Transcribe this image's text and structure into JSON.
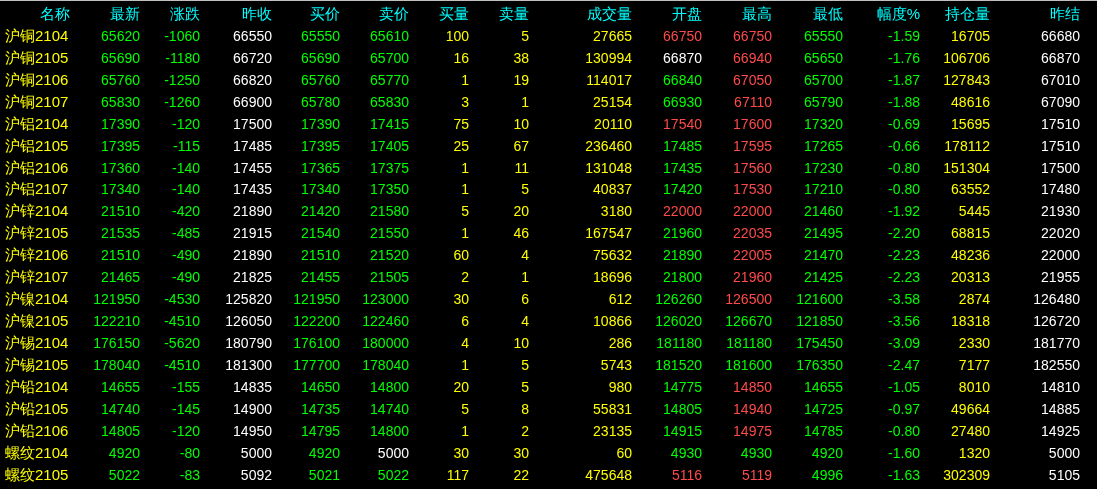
{
  "table": {
    "columns": [
      {
        "label": "名称",
        "kind": "name"
      },
      {
        "label": "最新",
        "kind": "price"
      },
      {
        "label": "涨跌",
        "kind": "price"
      },
      {
        "label": "昨收",
        "kind": "price"
      },
      {
        "label": "买价",
        "kind": "price"
      },
      {
        "label": "卖价",
        "kind": "price"
      },
      {
        "label": "买量",
        "kind": "volume"
      },
      {
        "label": "卖量",
        "kind": "volume"
      },
      {
        "label": "成交量",
        "kind": "volume"
      },
      {
        "label": "开盘",
        "kind": "price"
      },
      {
        "label": "最高",
        "kind": "price"
      },
      {
        "label": "最低",
        "kind": "price"
      },
      {
        "label": "幅度%",
        "kind": "price"
      },
      {
        "label": "持仓量",
        "kind": "volume"
      },
      {
        "label": "昨结",
        "kind": "price"
      }
    ],
    "rows": [
      {
        "cells": [
          {
            "value": "沪铜2104"
          },
          {
            "value": "65620",
            "color": "#00ff00"
          },
          {
            "value": "-1060",
            "color": "#00ff00"
          },
          {
            "value": "66550",
            "color": "#ffffff"
          },
          {
            "value": "65550",
            "color": "#00ff00"
          },
          {
            "value": "65610",
            "color": "#00ff00"
          },
          {
            "value": "100"
          },
          {
            "value": "5"
          },
          {
            "value": "27665"
          },
          {
            "value": "66750",
            "color": "#ff4a4a"
          },
          {
            "value": "66750",
            "color": "#ff4a4a"
          },
          {
            "value": "65550",
            "color": "#00ff00"
          },
          {
            "value": "-1.59",
            "color": "#00ff00"
          },
          {
            "value": "16705"
          },
          {
            "value": "66680",
            "color": "#ffffff"
          }
        ]
      },
      {
        "cells": [
          {
            "value": "沪铜2105"
          },
          {
            "value": "65690",
            "color": "#00ff00"
          },
          {
            "value": "-1180",
            "color": "#00ff00"
          },
          {
            "value": "66720",
            "color": "#ffffff"
          },
          {
            "value": "65690",
            "color": "#00ff00"
          },
          {
            "value": "65700",
            "color": "#00ff00"
          },
          {
            "value": "16"
          },
          {
            "value": "38"
          },
          {
            "value": "130994"
          },
          {
            "value": "66870",
            "color": "#ffffff"
          },
          {
            "value": "66940",
            "color": "#ff4a4a"
          },
          {
            "value": "65650",
            "color": "#00ff00"
          },
          {
            "value": "-1.76",
            "color": "#00ff00"
          },
          {
            "value": "106706"
          },
          {
            "value": "66870",
            "color": "#ffffff"
          }
        ]
      },
      {
        "cells": [
          {
            "value": "沪铜2106"
          },
          {
            "value": "65760",
            "color": "#00ff00"
          },
          {
            "value": "-1250",
            "color": "#00ff00"
          },
          {
            "value": "66820",
            "color": "#ffffff"
          },
          {
            "value": "65760",
            "color": "#00ff00"
          },
          {
            "value": "65770",
            "color": "#00ff00"
          },
          {
            "value": "1"
          },
          {
            "value": "19"
          },
          {
            "value": "114017"
          },
          {
            "value": "66840",
            "color": "#00ff00"
          },
          {
            "value": "67050",
            "color": "#ff4a4a"
          },
          {
            "value": "65700",
            "color": "#00ff00"
          },
          {
            "value": "-1.87",
            "color": "#00ff00"
          },
          {
            "value": "127843"
          },
          {
            "value": "67010",
            "color": "#ffffff"
          }
        ]
      },
      {
        "cells": [
          {
            "value": "沪铜2107"
          },
          {
            "value": "65830",
            "color": "#00ff00"
          },
          {
            "value": "-1260",
            "color": "#00ff00"
          },
          {
            "value": "66900",
            "color": "#ffffff"
          },
          {
            "value": "65780",
            "color": "#00ff00"
          },
          {
            "value": "65830",
            "color": "#00ff00"
          },
          {
            "value": "3"
          },
          {
            "value": "1"
          },
          {
            "value": "25154"
          },
          {
            "value": "66930",
            "color": "#00ff00"
          },
          {
            "value": "67110",
            "color": "#ff4a4a"
          },
          {
            "value": "65790",
            "color": "#00ff00"
          },
          {
            "value": "-1.88",
            "color": "#00ff00"
          },
          {
            "value": "48616"
          },
          {
            "value": "67090",
            "color": "#ffffff"
          }
        ]
      },
      {
        "cells": [
          {
            "value": "沪铝2104"
          },
          {
            "value": "17390",
            "color": "#00ff00"
          },
          {
            "value": "-120",
            "color": "#00ff00"
          },
          {
            "value": "17500",
            "color": "#ffffff"
          },
          {
            "value": "17390",
            "color": "#00ff00"
          },
          {
            "value": "17415",
            "color": "#00ff00"
          },
          {
            "value": "75"
          },
          {
            "value": "10"
          },
          {
            "value": "20110"
          },
          {
            "value": "17540",
            "color": "#ff4a4a"
          },
          {
            "value": "17600",
            "color": "#ff4a4a"
          },
          {
            "value": "17320",
            "color": "#00ff00"
          },
          {
            "value": "-0.69",
            "color": "#00ff00"
          },
          {
            "value": "15695"
          },
          {
            "value": "17510",
            "color": "#ffffff"
          }
        ]
      },
      {
        "cells": [
          {
            "value": "沪铝2105"
          },
          {
            "value": "17395",
            "color": "#00ff00"
          },
          {
            "value": "-115",
            "color": "#00ff00"
          },
          {
            "value": "17485",
            "color": "#ffffff"
          },
          {
            "value": "17395",
            "color": "#00ff00"
          },
          {
            "value": "17405",
            "color": "#00ff00"
          },
          {
            "value": "25"
          },
          {
            "value": "67"
          },
          {
            "value": "236460"
          },
          {
            "value": "17485",
            "color": "#00ff00"
          },
          {
            "value": "17595",
            "color": "#ff4a4a"
          },
          {
            "value": "17265",
            "color": "#00ff00"
          },
          {
            "value": "-0.66",
            "color": "#00ff00"
          },
          {
            "value": "178112"
          },
          {
            "value": "17510",
            "color": "#ffffff"
          }
        ]
      },
      {
        "cells": [
          {
            "value": "沪铝2106"
          },
          {
            "value": "17360",
            "color": "#00ff00"
          },
          {
            "value": "-140",
            "color": "#00ff00"
          },
          {
            "value": "17455",
            "color": "#ffffff"
          },
          {
            "value": "17365",
            "color": "#00ff00"
          },
          {
            "value": "17375",
            "color": "#00ff00"
          },
          {
            "value": "1"
          },
          {
            "value": "11"
          },
          {
            "value": "131048"
          },
          {
            "value": "17435",
            "color": "#00ff00"
          },
          {
            "value": "17560",
            "color": "#ff4a4a"
          },
          {
            "value": "17230",
            "color": "#00ff00"
          },
          {
            "value": "-0.80",
            "color": "#00ff00"
          },
          {
            "value": "151304"
          },
          {
            "value": "17500",
            "color": "#ffffff"
          }
        ]
      },
      {
        "cells": [
          {
            "value": "沪铝2107"
          },
          {
            "value": "17340",
            "color": "#00ff00"
          },
          {
            "value": "-140",
            "color": "#00ff00"
          },
          {
            "value": "17435",
            "color": "#ffffff"
          },
          {
            "value": "17340",
            "color": "#00ff00"
          },
          {
            "value": "17350",
            "color": "#00ff00"
          },
          {
            "value": "1"
          },
          {
            "value": "5"
          },
          {
            "value": "40837"
          },
          {
            "value": "17420",
            "color": "#00ff00"
          },
          {
            "value": "17530",
            "color": "#ff4a4a"
          },
          {
            "value": "17210",
            "color": "#00ff00"
          },
          {
            "value": "-0.80",
            "color": "#00ff00"
          },
          {
            "value": "63552"
          },
          {
            "value": "17480",
            "color": "#ffffff"
          }
        ]
      },
      {
        "cells": [
          {
            "value": "沪锌2104"
          },
          {
            "value": "21510",
            "color": "#00ff00"
          },
          {
            "value": "-420",
            "color": "#00ff00"
          },
          {
            "value": "21890",
            "color": "#ffffff"
          },
          {
            "value": "21420",
            "color": "#00ff00"
          },
          {
            "value": "21580",
            "color": "#00ff00"
          },
          {
            "value": "5"
          },
          {
            "value": "20"
          },
          {
            "value": "3180"
          },
          {
            "value": "22000",
            "color": "#ff4a4a"
          },
          {
            "value": "22000",
            "color": "#ff4a4a"
          },
          {
            "value": "21460",
            "color": "#00ff00"
          },
          {
            "value": "-1.92",
            "color": "#00ff00"
          },
          {
            "value": "5445"
          },
          {
            "value": "21930",
            "color": "#ffffff"
          }
        ]
      },
      {
        "cells": [
          {
            "value": "沪锌2105"
          },
          {
            "value": "21535",
            "color": "#00ff00"
          },
          {
            "value": "-485",
            "color": "#00ff00"
          },
          {
            "value": "21915",
            "color": "#ffffff"
          },
          {
            "value": "21540",
            "color": "#00ff00"
          },
          {
            "value": "21550",
            "color": "#00ff00"
          },
          {
            "value": "1"
          },
          {
            "value": "46"
          },
          {
            "value": "167547"
          },
          {
            "value": "21960",
            "color": "#00ff00"
          },
          {
            "value": "22035",
            "color": "#ff4a4a"
          },
          {
            "value": "21495",
            "color": "#00ff00"
          },
          {
            "value": "-2.20",
            "color": "#00ff00"
          },
          {
            "value": "68815"
          },
          {
            "value": "22020",
            "color": "#ffffff"
          }
        ]
      },
      {
        "cells": [
          {
            "value": "沪锌2106"
          },
          {
            "value": "21510",
            "color": "#00ff00"
          },
          {
            "value": "-490",
            "color": "#00ff00"
          },
          {
            "value": "21890",
            "color": "#ffffff"
          },
          {
            "value": "21510",
            "color": "#00ff00"
          },
          {
            "value": "21520",
            "color": "#00ff00"
          },
          {
            "value": "60"
          },
          {
            "value": "4"
          },
          {
            "value": "75632"
          },
          {
            "value": "21890",
            "color": "#00ff00"
          },
          {
            "value": "22005",
            "color": "#ff4a4a"
          },
          {
            "value": "21470",
            "color": "#00ff00"
          },
          {
            "value": "-2.23",
            "color": "#00ff00"
          },
          {
            "value": "48236"
          },
          {
            "value": "22000",
            "color": "#ffffff"
          }
        ]
      },
      {
        "cells": [
          {
            "value": "沪锌2107"
          },
          {
            "value": "21465",
            "color": "#00ff00"
          },
          {
            "value": "-490",
            "color": "#00ff00"
          },
          {
            "value": "21825",
            "color": "#ffffff"
          },
          {
            "value": "21455",
            "color": "#00ff00"
          },
          {
            "value": "21505",
            "color": "#00ff00"
          },
          {
            "value": "2"
          },
          {
            "value": "1"
          },
          {
            "value": "18696"
          },
          {
            "value": "21800",
            "color": "#00ff00"
          },
          {
            "value": "21960",
            "color": "#ff4a4a"
          },
          {
            "value": "21425",
            "color": "#00ff00"
          },
          {
            "value": "-2.23",
            "color": "#00ff00"
          },
          {
            "value": "20313"
          },
          {
            "value": "21955",
            "color": "#ffffff"
          }
        ]
      },
      {
        "cells": [
          {
            "value": "沪镍2104"
          },
          {
            "value": "121950",
            "color": "#00ff00"
          },
          {
            "value": "-4530",
            "color": "#00ff00"
          },
          {
            "value": "125820",
            "color": "#ffffff"
          },
          {
            "value": "121950",
            "color": "#00ff00"
          },
          {
            "value": "123000",
            "color": "#00ff00"
          },
          {
            "value": "30"
          },
          {
            "value": "6"
          },
          {
            "value": "612"
          },
          {
            "value": "126260",
            "color": "#00ff00"
          },
          {
            "value": "126500",
            "color": "#ff4a4a"
          },
          {
            "value": "121600",
            "color": "#00ff00"
          },
          {
            "value": "-3.58",
            "color": "#00ff00"
          },
          {
            "value": "2874"
          },
          {
            "value": "126480",
            "color": "#ffffff"
          }
        ]
      },
      {
        "cells": [
          {
            "value": "沪镍2105"
          },
          {
            "value": "122210",
            "color": "#00ff00"
          },
          {
            "value": "-4510",
            "color": "#00ff00"
          },
          {
            "value": "126050",
            "color": "#ffffff"
          },
          {
            "value": "122200",
            "color": "#00ff00"
          },
          {
            "value": "122460",
            "color": "#00ff00"
          },
          {
            "value": "6"
          },
          {
            "value": "4"
          },
          {
            "value": "10866"
          },
          {
            "value": "126020",
            "color": "#00ff00"
          },
          {
            "value": "126670",
            "color": "#00ff00"
          },
          {
            "value": "121850",
            "color": "#00ff00"
          },
          {
            "value": "-3.56",
            "color": "#00ff00"
          },
          {
            "value": "18318"
          },
          {
            "value": "126720",
            "color": "#ffffff"
          }
        ]
      },
      {
        "cells": [
          {
            "value": "沪锡2104"
          },
          {
            "value": "176150",
            "color": "#00ff00"
          },
          {
            "value": "-5620",
            "color": "#00ff00"
          },
          {
            "value": "180790",
            "color": "#ffffff"
          },
          {
            "value": "176100",
            "color": "#00ff00"
          },
          {
            "value": "180000",
            "color": "#00ff00"
          },
          {
            "value": "4"
          },
          {
            "value": "10"
          },
          {
            "value": "286"
          },
          {
            "value": "181180",
            "color": "#00ff00"
          },
          {
            "value": "181180",
            "color": "#00ff00"
          },
          {
            "value": "175450",
            "color": "#00ff00"
          },
          {
            "value": "-3.09",
            "color": "#00ff00"
          },
          {
            "value": "2330"
          },
          {
            "value": "181770",
            "color": "#ffffff"
          }
        ]
      },
      {
        "cells": [
          {
            "value": "沪锡2105"
          },
          {
            "value": "178040",
            "color": "#00ff00"
          },
          {
            "value": "-4510",
            "color": "#00ff00"
          },
          {
            "value": "181300",
            "color": "#ffffff"
          },
          {
            "value": "177700",
            "color": "#00ff00"
          },
          {
            "value": "178040",
            "color": "#00ff00"
          },
          {
            "value": "1"
          },
          {
            "value": "5"
          },
          {
            "value": "5743"
          },
          {
            "value": "181520",
            "color": "#00ff00"
          },
          {
            "value": "181600",
            "color": "#00ff00"
          },
          {
            "value": "176350",
            "color": "#00ff00"
          },
          {
            "value": "-2.47",
            "color": "#00ff00"
          },
          {
            "value": "7177"
          },
          {
            "value": "182550",
            "color": "#ffffff"
          }
        ]
      },
      {
        "cells": [
          {
            "value": "沪铅2104"
          },
          {
            "value": "14655",
            "color": "#00ff00"
          },
          {
            "value": "-155",
            "color": "#00ff00"
          },
          {
            "value": "14835",
            "color": "#ffffff"
          },
          {
            "value": "14650",
            "color": "#00ff00"
          },
          {
            "value": "14800",
            "color": "#00ff00"
          },
          {
            "value": "20"
          },
          {
            "value": "5"
          },
          {
            "value": "980"
          },
          {
            "value": "14775",
            "color": "#00ff00"
          },
          {
            "value": "14850",
            "color": "#ff4a4a"
          },
          {
            "value": "14655",
            "color": "#00ff00"
          },
          {
            "value": "-1.05",
            "color": "#00ff00"
          },
          {
            "value": "8010"
          },
          {
            "value": "14810",
            "color": "#ffffff"
          }
        ]
      },
      {
        "cells": [
          {
            "value": "沪铅2105"
          },
          {
            "value": "14740",
            "color": "#00ff00"
          },
          {
            "value": "-145",
            "color": "#00ff00"
          },
          {
            "value": "14900",
            "color": "#ffffff"
          },
          {
            "value": "14735",
            "color": "#00ff00"
          },
          {
            "value": "14740",
            "color": "#00ff00"
          },
          {
            "value": "5"
          },
          {
            "value": "8"
          },
          {
            "value": "55831"
          },
          {
            "value": "14805",
            "color": "#00ff00"
          },
          {
            "value": "14940",
            "color": "#ff4a4a"
          },
          {
            "value": "14725",
            "color": "#00ff00"
          },
          {
            "value": "-0.97",
            "color": "#00ff00"
          },
          {
            "value": "49664"
          },
          {
            "value": "14885",
            "color": "#ffffff"
          }
        ]
      },
      {
        "cells": [
          {
            "value": "沪铅2106"
          },
          {
            "value": "14805",
            "color": "#00ff00"
          },
          {
            "value": "-120",
            "color": "#00ff00"
          },
          {
            "value": "14950",
            "color": "#ffffff"
          },
          {
            "value": "14795",
            "color": "#00ff00"
          },
          {
            "value": "14800",
            "color": "#00ff00"
          },
          {
            "value": "1"
          },
          {
            "value": "2"
          },
          {
            "value": "23135"
          },
          {
            "value": "14915",
            "color": "#00ff00"
          },
          {
            "value": "14975",
            "color": "#ff4a4a"
          },
          {
            "value": "14785",
            "color": "#00ff00"
          },
          {
            "value": "-0.80",
            "color": "#00ff00"
          },
          {
            "value": "27480"
          },
          {
            "value": "14925",
            "color": "#ffffff"
          }
        ]
      },
      {
        "cells": [
          {
            "value": "螺纹2104"
          },
          {
            "value": "4920",
            "color": "#00ff00"
          },
          {
            "value": "-80",
            "color": "#00ff00"
          },
          {
            "value": "5000",
            "color": "#ffffff"
          },
          {
            "value": "4920",
            "color": "#00ff00"
          },
          {
            "value": "5000",
            "color": "#ffffff"
          },
          {
            "value": "30"
          },
          {
            "value": "30"
          },
          {
            "value": "60"
          },
          {
            "value": "4930",
            "color": "#00ff00"
          },
          {
            "value": "4930",
            "color": "#00ff00"
          },
          {
            "value": "4920",
            "color": "#00ff00"
          },
          {
            "value": "-1.60",
            "color": "#00ff00"
          },
          {
            "value": "1320"
          },
          {
            "value": "5000",
            "color": "#ffffff"
          }
        ]
      },
      {
        "cells": [
          {
            "value": "螺纹2105"
          },
          {
            "value": "5022",
            "color": "#00ff00"
          },
          {
            "value": "-83",
            "color": "#00ff00"
          },
          {
            "value": "5092",
            "color": "#ffffff"
          },
          {
            "value": "5021",
            "color": "#00ff00"
          },
          {
            "value": "5022",
            "color": "#00ff00"
          },
          {
            "value": "117"
          },
          {
            "value": "22"
          },
          {
            "value": "475648"
          },
          {
            "value": "5116",
            "color": "#ff4a4a"
          },
          {
            "value": "5119",
            "color": "#ff4a4a"
          },
          {
            "value": "4996",
            "color": "#00ff00"
          },
          {
            "value": "-1.63",
            "color": "#00ff00"
          },
          {
            "value": "302309"
          },
          {
            "value": "5105",
            "color": "#ffffff"
          }
        ]
      }
    ]
  }
}
